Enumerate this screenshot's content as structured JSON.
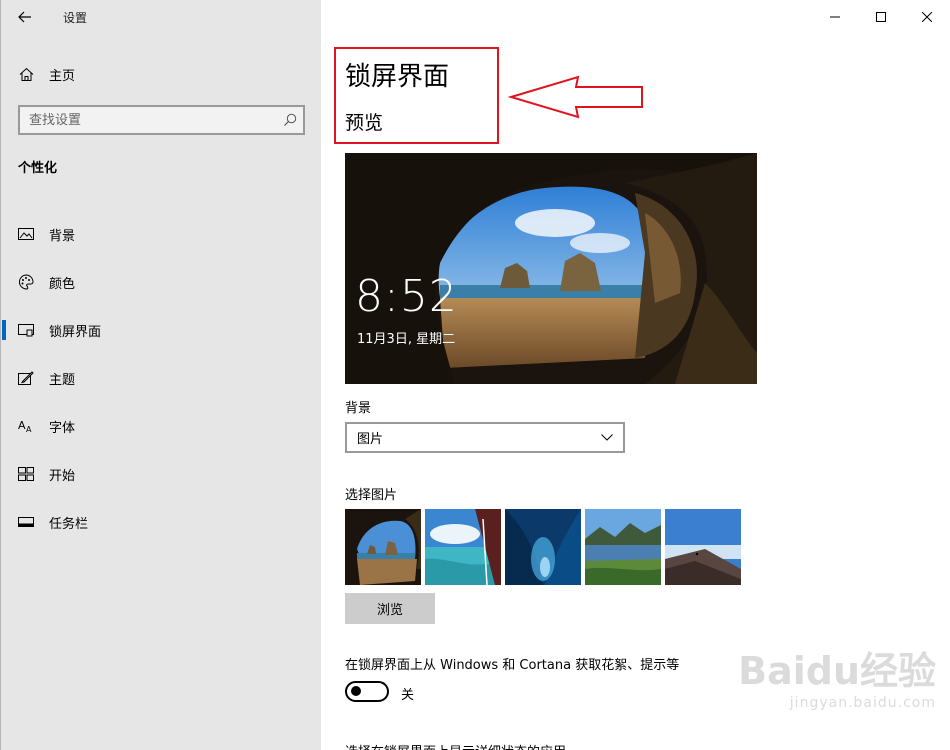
{
  "window": {
    "title": "设置"
  },
  "sidebar": {
    "home_label": "主页",
    "search_placeholder": "查找设置",
    "section_title": "个性化",
    "items": [
      {
        "label": "背景",
        "icon": "image-icon"
      },
      {
        "label": "颜色",
        "icon": "palette-icon"
      },
      {
        "label": "锁屏界面",
        "icon": "lock-screen-icon",
        "active": true
      },
      {
        "label": "主题",
        "icon": "theme-icon"
      },
      {
        "label": "字体",
        "icon": "font-icon"
      },
      {
        "label": "开始",
        "icon": "start-icon"
      },
      {
        "label": "任务栏",
        "icon": "taskbar-icon"
      }
    ]
  },
  "main": {
    "page_title": "锁屏界面",
    "preview_title": "预览",
    "preview_time": "8:52",
    "preview_date": "11月3日, 星期二",
    "background_label": "背景",
    "background_value": "图片",
    "choose_picture_label": "选择图片",
    "browse_label": "浏览",
    "fun_facts_label": "在锁屏界面上从 Windows 和 Cortana 获取花絮、提示等",
    "toggle_state": "关",
    "toggle_on": false,
    "next_section_partial": "选择在锁屏界面上显示详细状态的应用"
  },
  "watermark": {
    "main": "Baidu经验",
    "sub": "jingyan.baidu.com"
  },
  "colors": {
    "accent": "#0067c0",
    "annotation": "#e0141e",
    "sidebar_bg": "#e6e6e6"
  }
}
